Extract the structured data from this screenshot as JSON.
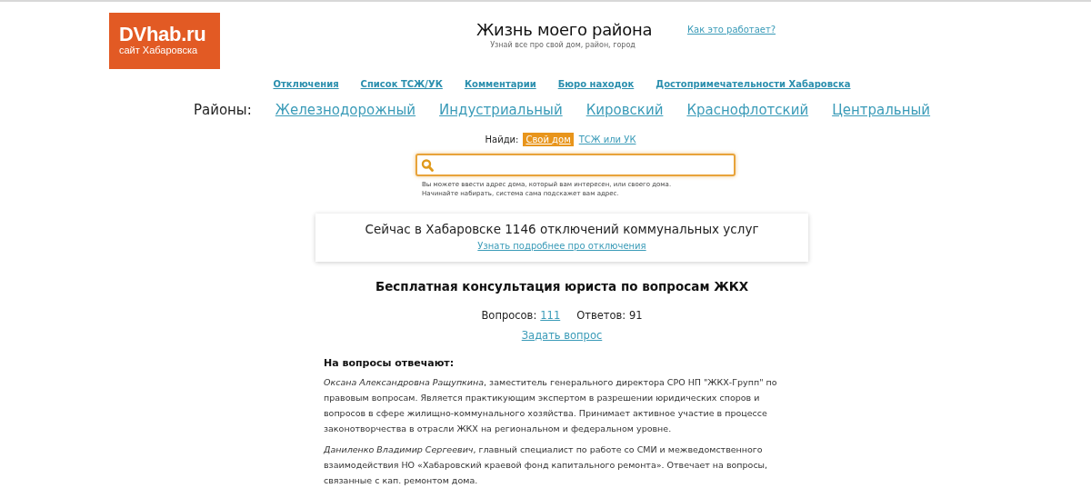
{
  "logo": {
    "name": "DVhab.ru",
    "tagline": "сайт Хабаровска"
  },
  "header": {
    "title": "Жизнь моего района",
    "subtitle": "Узнай все про свой дом, район, город",
    "help_link": "Как это работает?"
  },
  "nav": [
    "Отключения",
    "Список ТСЖ/УК",
    "Комментарии",
    "Бюро находок",
    "Достопримечательности Хабаровска"
  ],
  "districts": {
    "label": "Районы:",
    "items": [
      "Железнодорожный",
      "Индустриальный",
      "Кировский",
      "Краснофлотский",
      "Центральный"
    ]
  },
  "search": {
    "label": "Найди:",
    "tabs": [
      {
        "label": "Свой дом",
        "selected": true
      },
      {
        "label": "ТСЖ или УК",
        "selected": false
      }
    ],
    "hint": [
      "Вы можете ввести адрес дома, который вам интересен, или своего дома.",
      "Начинайте набирать, система сама подскажет вам адрес."
    ]
  },
  "outages": {
    "text": "Сейчас в Хабаровске 1146 отключений коммунальных услуг",
    "link": "Узнать подробнее про отключения"
  },
  "consultation": {
    "title": "Бесплатная консультация юриста по вопросам ЖКХ",
    "questions_label": "Вопросов:",
    "questions_count": "111",
    "answers": "Ответов: 91",
    "ask_link": "Задать вопрос",
    "experts_title": "На вопросы отвечают:",
    "experts": [
      "*Оксана Александровна Ращупкина*, заместитель генерального директора  СРО НП \"ЖКХ-Групп\" по правовым вопросам. Является практикующим экспертом в разрешении юридических споров и вопросов в сфере жилищно-коммунального хозяйства. Принимает активное участие в процессе законотворчества в отрасли ЖКХ на региональном и федеральном уровне.",
      "*Даниленко Владимир Сергеевич*, главный специалист по работе со СМИ и межведомственного взаимодействия НО «Хабаровский краевой фонд капитального ремонта». Отвечает на вопросы, связанные с кап. ремонтом дома."
    ]
  }
}
